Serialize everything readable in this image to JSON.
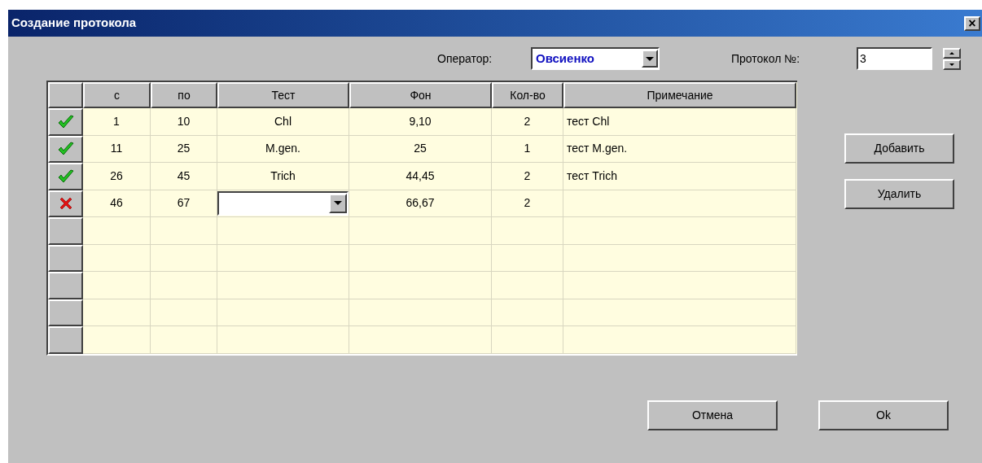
{
  "window": {
    "title": "Создание протокола",
    "close": "×"
  },
  "operator": {
    "label": "Оператор:",
    "value": "Овсиенко"
  },
  "protocol": {
    "label": "Протокол №:",
    "value": "3"
  },
  "table": {
    "columns": [
      "с",
      "по",
      "Тест",
      "Фон",
      "Кол-во",
      "Примечание"
    ],
    "rows": [
      {
        "kind": "ok",
        "cells": [
          "1",
          "10",
          "Chl",
          "9,10",
          "2",
          "тест Chl"
        ]
      },
      {
        "kind": "ok",
        "cells": [
          "11",
          "25",
          "M.gen.",
          "25",
          "1",
          "тест M.gen."
        ]
      },
      {
        "kind": "ok",
        "cells": [
          "26",
          "45",
          "Trich",
          "44,45",
          "2",
          "тест Trich"
        ]
      },
      {
        "kind": "error",
        "cells": [
          "46",
          "67",
          {
            "kind": "dropdown"
          },
          "66,67",
          "2",
          ""
        ]
      },
      {
        "kind": "blank"
      },
      {
        "kind": "blank"
      },
      {
        "kind": "blank"
      },
      {
        "kind": "blank"
      },
      {
        "kind": "blank"
      }
    ]
  },
  "side_buttons": [
    "Добавить",
    "Удалить"
  ],
  "buttons": [
    "Отмена",
    "Ok"
  ]
}
